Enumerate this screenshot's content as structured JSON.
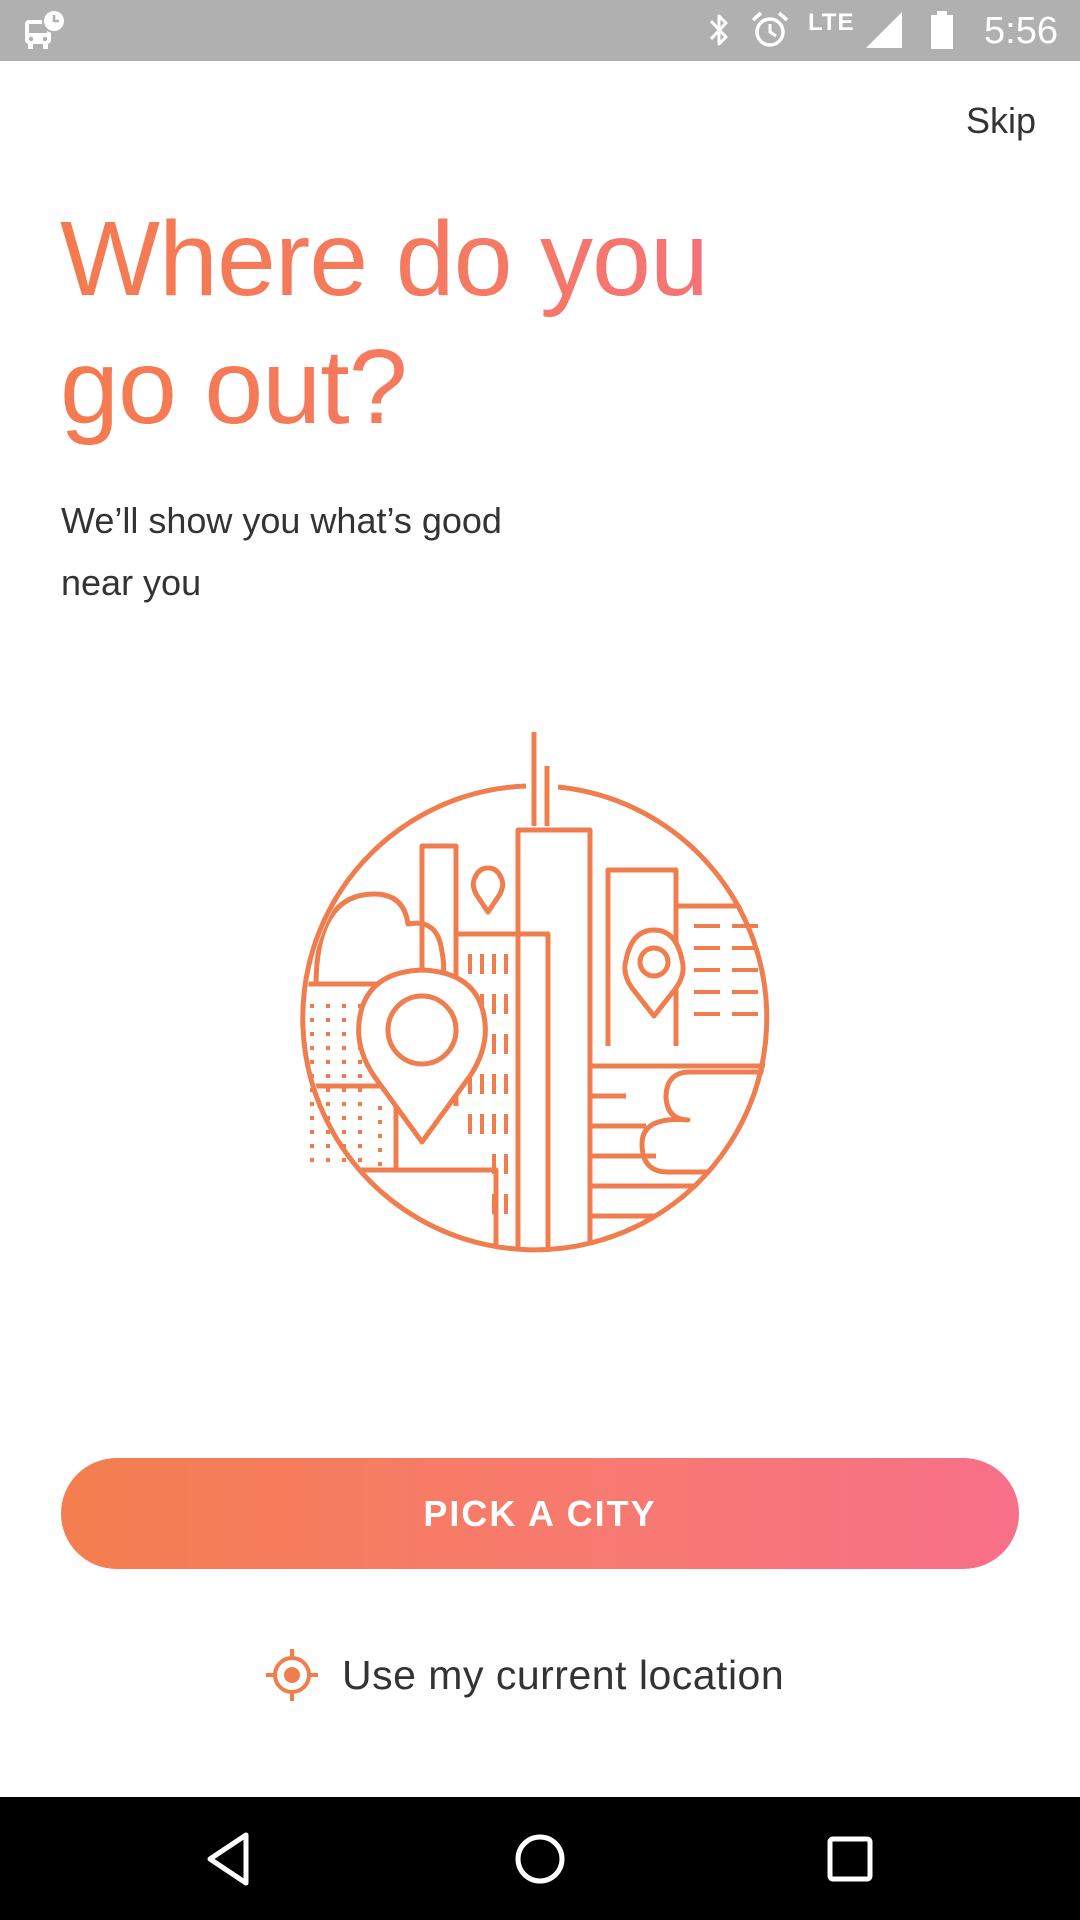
{
  "status_bar": {
    "time": "5:56",
    "network_label": "LTE",
    "icons": [
      "transit-notification-icon",
      "bluetooth-icon",
      "alarm-icon",
      "signal-icon",
      "battery-icon"
    ]
  },
  "skip_label": "Skip",
  "headline": {
    "line1": "Where do you",
    "line2": "go out?"
  },
  "subtitle": {
    "line1": "We’ll show you what’s good",
    "line2": "near you"
  },
  "illustration": {
    "icon": "city-map-illustration",
    "color": "#f07d4e"
  },
  "primary_button_label": "PICK A CITY",
  "location_link_label": "Use my current location",
  "colors": {
    "accent_orange": "#f47b4f",
    "accent_pink": "#f66e80",
    "text": "#333333",
    "status_bar_bg": "#b0b0b0",
    "nav_bar_bg": "#000000"
  },
  "navigation": {
    "buttons": [
      "back-icon",
      "home-icon",
      "recents-icon"
    ]
  }
}
